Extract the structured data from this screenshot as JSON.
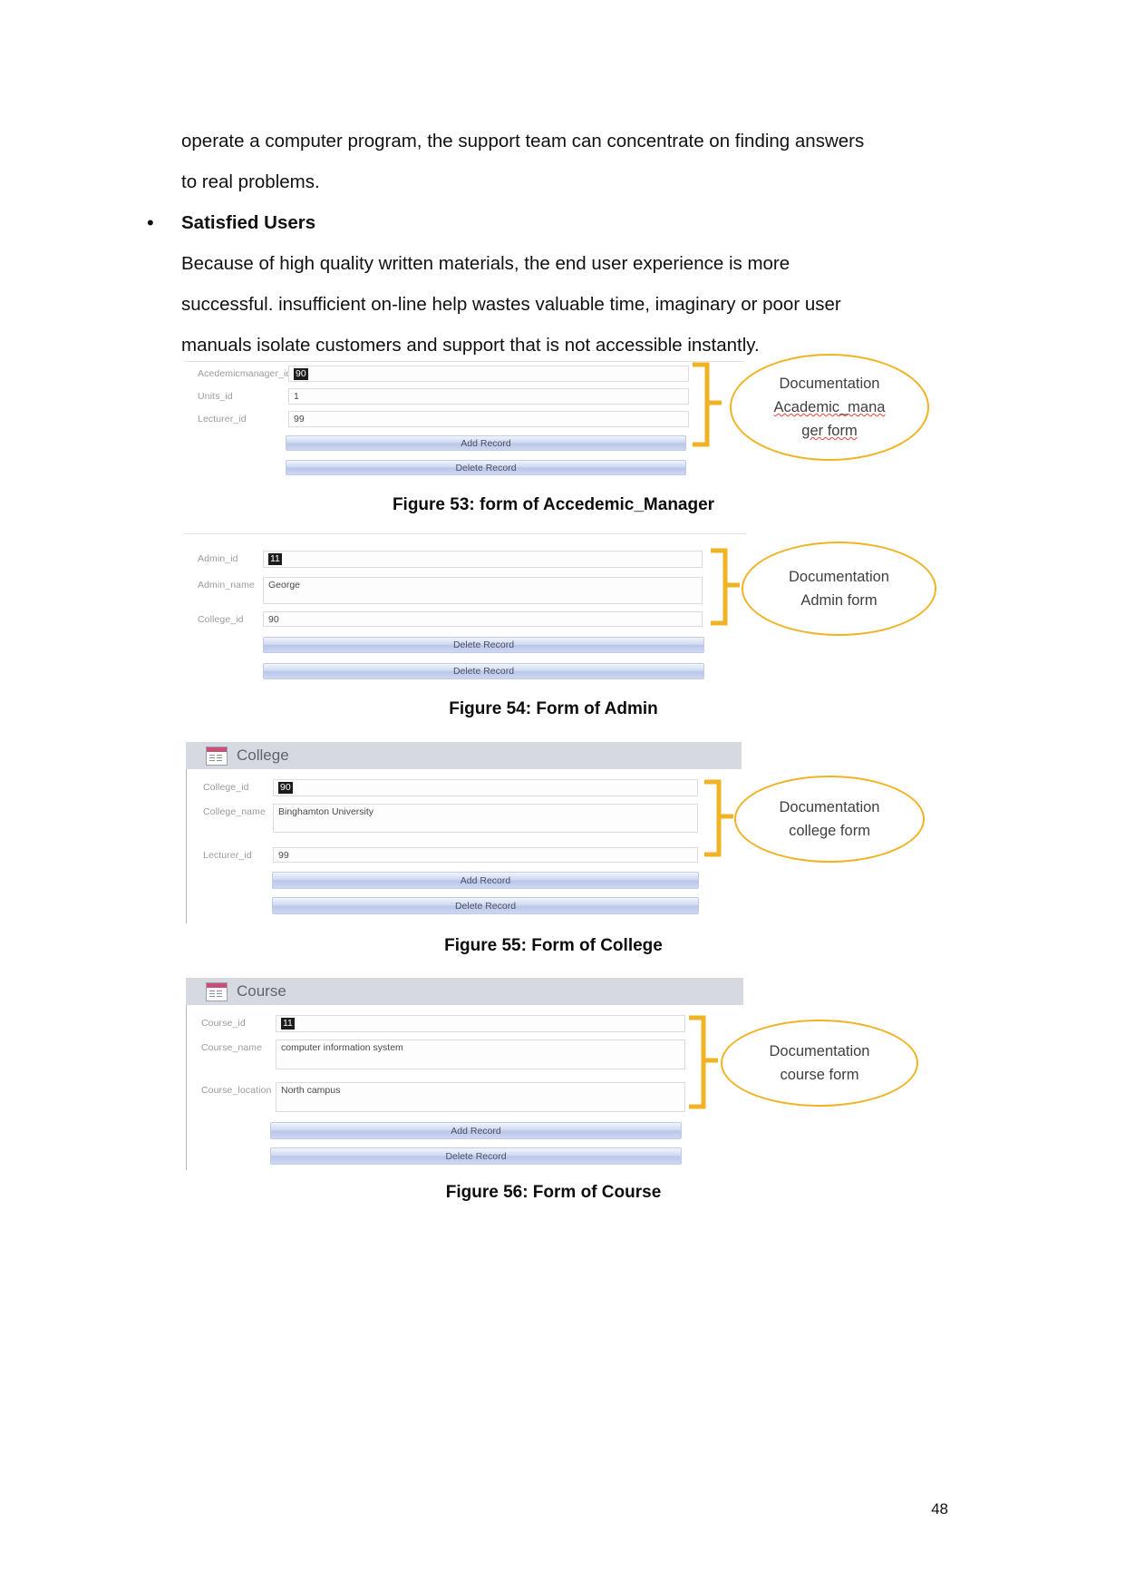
{
  "document": {
    "page_number": "48",
    "body": {
      "paragraph_lines": [
        "operate a computer program, the support team can concentrate on finding answers",
        "to real problems."
      ],
      "bullet_marker": "•",
      "bullet_heading": "Satisfied Users",
      "bullet_body_lines": [
        "Because of high quality written materials, the end user experience is more",
        "successful. insufficient on-line help wastes valuable time, imaginary or poor user",
        "manuals isolate customers and support that is not accessible instantly."
      ]
    },
    "figures": [
      {
        "id": "figure-53",
        "caption": "Figure 53: form of Accedemic_Manager",
        "window_title": null,
        "fields": [
          {
            "label": "Acedemicmanager_id",
            "value": "90",
            "selected": true,
            "tall": false
          },
          {
            "label": "Units_id",
            "value": "1",
            "selected": false,
            "tall": false
          },
          {
            "label": "Lecturer_id",
            "value": "99",
            "selected": false,
            "tall": false
          }
        ],
        "buttons": [
          "Add Record",
          "Delete Record"
        ],
        "annotation_lines": [
          "Documentation",
          "Academic_mana",
          "ger form"
        ],
        "annotation_misspelled": [
          false,
          true,
          true
        ]
      },
      {
        "id": "figure-54",
        "caption": "Figure 54: Form of Admin",
        "window_title": null,
        "fields": [
          {
            "label": "Admin_id",
            "value": "11",
            "selected": true,
            "tall": false
          },
          {
            "label": "Admin_name",
            "value": "George",
            "selected": false,
            "tall": true
          },
          {
            "label": "College_id",
            "value": "90",
            "selected": false,
            "tall": false
          }
        ],
        "buttons": [
          "Delete Record",
          "Delete Record"
        ],
        "annotation_lines": [
          "Documentation",
          "Admin form"
        ],
        "annotation_misspelled": [
          false,
          false
        ]
      },
      {
        "id": "figure-55",
        "caption": "Figure 55: Form of College",
        "window_title": "College",
        "fields": [
          {
            "label": "College_id",
            "value": "90",
            "selected": true,
            "tall": false
          },
          {
            "label": "College_name",
            "value": "Binghamton University",
            "selected": false,
            "tall": true
          },
          {
            "label": "Lecturer_id",
            "value": "99",
            "selected": false,
            "tall": false
          }
        ],
        "buttons": [
          "Add Record",
          "Delete Record"
        ],
        "annotation_lines": [
          "Documentation",
          "college form"
        ],
        "annotation_misspelled": [
          false,
          false
        ]
      },
      {
        "id": "figure-56",
        "caption": "Figure 56: Form of Course",
        "window_title": "Course",
        "fields": [
          {
            "label": "Course_id",
            "value": "11",
            "selected": true,
            "tall": false
          },
          {
            "label": "Course_name",
            "value": "computer information system",
            "selected": false,
            "tall": true
          },
          {
            "label": "Course_location",
            "value": "North campus",
            "selected": false,
            "tall": true
          }
        ],
        "buttons": [
          "Add Record",
          "Delete Record"
        ],
        "annotation_lines": [
          "Documentation",
          "course form"
        ],
        "annotation_misspelled": [
          false,
          false
        ]
      }
    ],
    "colors": {
      "annotation": "#f0b323",
      "button_blue": "#c2cbe4",
      "titlebar": "#d6d9e0",
      "spellcheck_red": "#e8413c"
    }
  }
}
